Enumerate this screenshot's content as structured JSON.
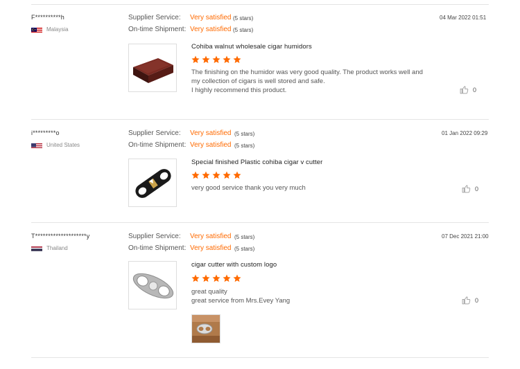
{
  "colors": {
    "accent": "#ff6a00",
    "divider": "#e4e4e4"
  },
  "labels": {
    "supplier_service": "Supplier Service:",
    "ontime_shipment": "On-time Shipment:"
  },
  "reviews": [
    {
      "buyer": "F**********h",
      "country": "Malaysia",
      "flag_icon": "malaysia-flag-icon",
      "supplier_service": "Very satisfied",
      "supplier_stars": "(5 stars)",
      "ontime_shipment": "Very satisfied",
      "ontime_stars": "(5 stars)",
      "date": "04 Mar 2022 01:51",
      "product_image": "humidor-product-image",
      "product_title": "Cohiba walnut wholesale cigar humidors",
      "rating": 5,
      "feedback": "The finishing on the humidor was very good quality. The product works well and\nmy collection of cigars is well stored and safe.\nI highly recommend this product.",
      "likes": "0"
    },
    {
      "buyer": "i*********o",
      "country": "United States",
      "flag_icon": "united-states-flag-icon",
      "supplier_service": "Very satisfied",
      "supplier_stars": "(5 stars)",
      "ontime_shipment": "Very satisfied",
      "ontime_stars": "(5 stars)",
      "date": "01 Jan 2022 09:29",
      "product_image": "black-v-cutter-product-image",
      "product_title": "Special finished Plastic cohiba cigar v cutter",
      "rating": 5,
      "feedback": "very good service thank you very much",
      "likes": "0"
    },
    {
      "buyer": "T********************y",
      "country": "Thailand",
      "flag_icon": "thailand-flag-icon",
      "supplier_service": "Very satisfied",
      "supplier_stars": "(5 stars)",
      "ontime_shipment": "Very satisfied",
      "ontime_stars": "(5 stars)",
      "date": "07 Dec 2021 21:00",
      "product_image": "steel-cutter-product-image",
      "product_title": "cigar cutter with custom logo",
      "rating": 5,
      "feedback": "great quality\ngreat service from Mrs.Evey Yang",
      "likes": "0",
      "attachment": "review-photo-thumbnail"
    }
  ]
}
